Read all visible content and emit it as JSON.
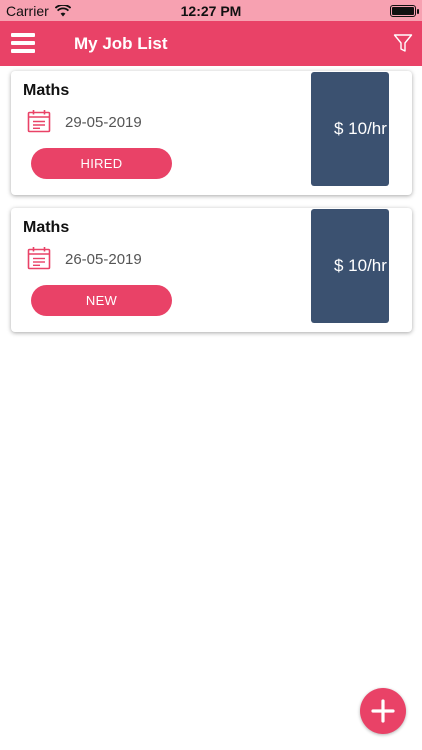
{
  "status_bar": {
    "carrier": "Carrier",
    "time": "12:27 PM"
  },
  "app_bar": {
    "title": "My Job List",
    "menu_icon": "hamburger-menu-icon",
    "filter_icon": "filter-funnel-icon"
  },
  "jobs": [
    {
      "subject": "Maths",
      "date": "29-05-2019",
      "status": "HIRED",
      "rate": "$ 10/hr"
    },
    {
      "subject": "Maths",
      "date": "26-05-2019",
      "status": "NEW",
      "rate": "$ 10/hr"
    }
  ],
  "fab": {
    "icon": "plus-icon"
  },
  "colors": {
    "primary": "#e94267",
    "status_bar": "#f7a1b1",
    "rate_bg": "#3b5170"
  }
}
